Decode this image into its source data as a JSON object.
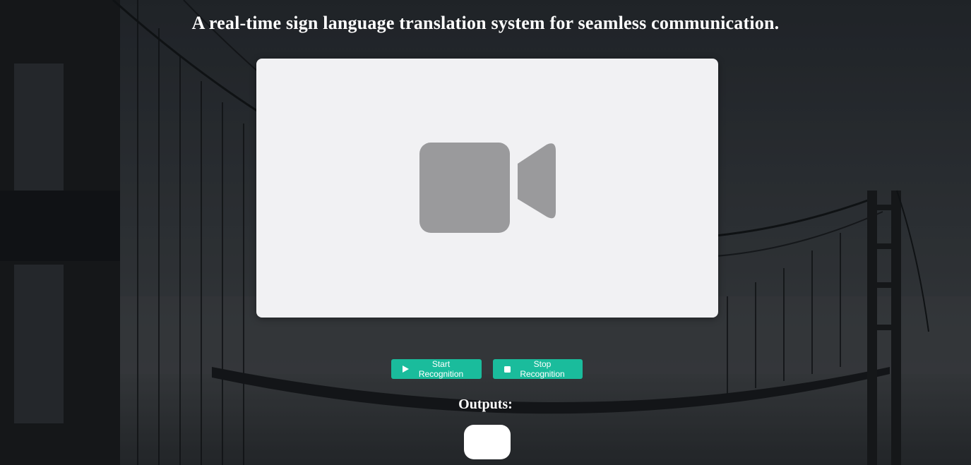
{
  "page": {
    "title": "A real-time sign language translation system for seamless communication."
  },
  "video": {
    "icon": "video-camera-icon",
    "icon_color": "#9a9a9c",
    "panel_color": "#f1f1f3"
  },
  "controls": {
    "start_label": "Start Recognition",
    "start_icon": "play-icon",
    "stop_label": "Stop Recognition",
    "stop_icon": "stop-icon",
    "button_color": "#1abc9c"
  },
  "outputs": {
    "label": "Outputs:",
    "value": ""
  }
}
